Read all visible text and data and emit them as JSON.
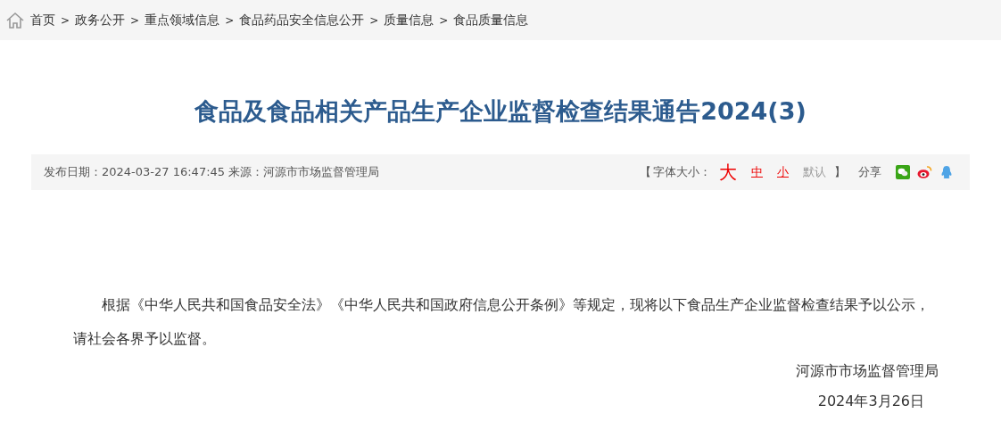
{
  "breadcrumb": {
    "separator": ">",
    "items": [
      {
        "label": "首页"
      },
      {
        "label": "政务公开"
      },
      {
        "label": "重点领域信息"
      },
      {
        "label": "食品药品安全信息公开"
      },
      {
        "label": "质量信息"
      },
      {
        "label": "食品质量信息"
      }
    ]
  },
  "article": {
    "title": "食品及食品相关产品生产企业监督检查结果通告2024(3)",
    "meta": "发布日期：2024-03-27 16:47:45 来源：河源市市场监督管理局",
    "font_size": {
      "open": "【",
      "label": "字体大小：",
      "close": "】",
      "options": [
        {
          "label": "大",
          "kind": "large"
        },
        {
          "label": "中",
          "kind": "medium"
        },
        {
          "label": "小",
          "kind": "small"
        },
        {
          "label": "默认",
          "kind": "default"
        }
      ]
    },
    "share": {
      "label": "分享",
      "targets": [
        {
          "kind": "wechat"
        },
        {
          "kind": "weibo"
        },
        {
          "kind": "qq"
        }
      ]
    },
    "body": "根据《中华人民共和国食品安全法》《中华人民共和国政府信息公开条例》等规定，现将以下食品生产企业监督检查结果予以公示，请社会各界予以监督。",
    "signature": "河源市市场监督管理局",
    "date": "2024年3月26日"
  }
}
